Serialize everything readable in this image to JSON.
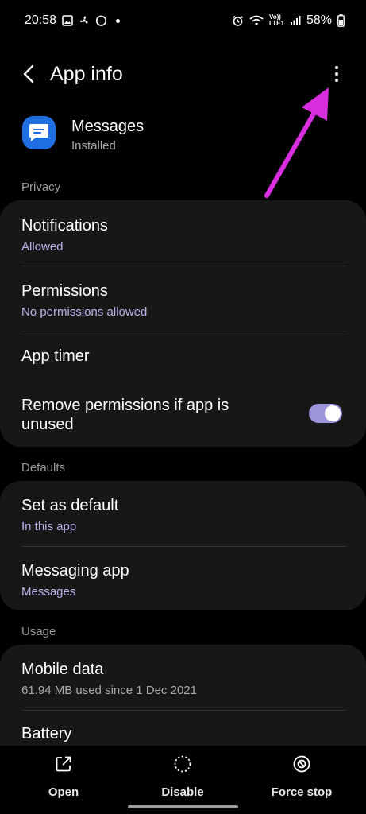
{
  "status_bar": {
    "time": "20:58",
    "volte_top": "Vo))",
    "volte_bottom": "LTE1",
    "battery": "58%"
  },
  "header": {
    "title": "App info"
  },
  "app": {
    "name": "Messages",
    "status": "Installed"
  },
  "sections": {
    "privacy": "Privacy",
    "defaults": "Defaults",
    "usage": "Usage"
  },
  "privacy_items": {
    "notifications": {
      "title": "Notifications",
      "sub": "Allowed"
    },
    "permissions": {
      "title": "Permissions",
      "sub": "No permissions allowed"
    },
    "app_timer": {
      "title": "App timer"
    },
    "remove_permissions": {
      "title": "Remove permissions if app is unused",
      "enabled": true
    }
  },
  "defaults_items": {
    "set_default": {
      "title": "Set as default",
      "sub": "In this app"
    },
    "messaging_app": {
      "title": "Messaging app",
      "sub": "Messages"
    }
  },
  "usage_items": {
    "mobile_data": {
      "title": "Mobile data",
      "sub": "61.94 MB used since 1 Dec 2021"
    },
    "battery": {
      "title": "Battery"
    }
  },
  "actions": {
    "open": "Open",
    "disable": "Disable",
    "force_stop": "Force stop"
  },
  "colors": {
    "accent": "#b6b3e8",
    "toggle": "#9b96dc",
    "arrow": "#d82ee0",
    "app_icon": "#1f6fe0"
  },
  "icons": [
    "image-icon",
    "fan-icon",
    "whatsapp-icon",
    "alarm-icon",
    "wifi-icon",
    "signal-icon",
    "battery-icon",
    "back-icon",
    "more-icon",
    "messages-app-icon",
    "open-icon",
    "disable-icon",
    "force-stop-icon",
    "annotation-arrow"
  ]
}
